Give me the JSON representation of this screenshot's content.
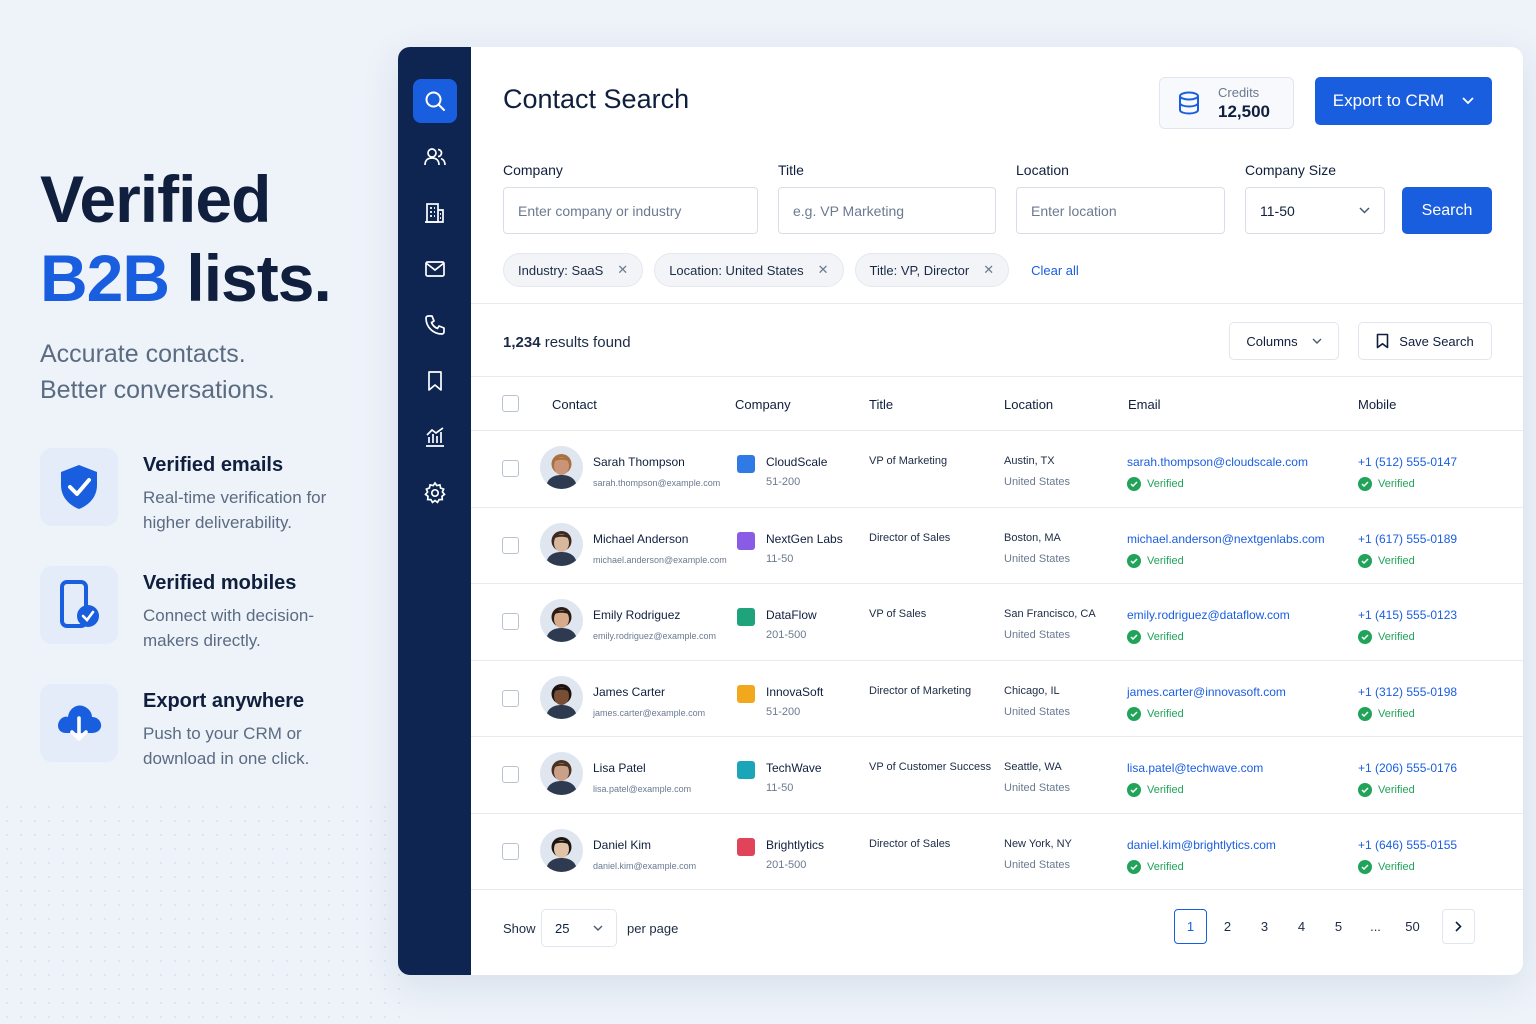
{
  "promo": {
    "headline_line1": "Verified",
    "headline_accent": "B2B",
    "headline_rest": " lists.",
    "subtitle_line1": "Accurate contacts.",
    "subtitle_line2": "Better conversations.",
    "features": [
      {
        "title": "Verified emails",
        "desc": "Real-time verification for higher deliverability.",
        "icon": "shield-check-icon"
      },
      {
        "title": "Verified mobiles",
        "desc": "Connect with decision-makers directly.",
        "icon": "phone-check-icon"
      },
      {
        "title": "Export anywhere",
        "desc": "Push to your CRM or download in one click.",
        "icon": "cloud-download-icon"
      }
    ]
  },
  "sidebar": {
    "items": [
      {
        "icon": "search-icon",
        "active": true
      },
      {
        "icon": "users-icon"
      },
      {
        "icon": "building-icon"
      },
      {
        "icon": "mail-icon"
      },
      {
        "icon": "phone-icon"
      },
      {
        "icon": "bookmark-icon"
      },
      {
        "icon": "analytics-icon"
      },
      {
        "icon": "settings-icon"
      }
    ]
  },
  "header": {
    "title": "Contact Search",
    "credits_label": "Credits",
    "credits_value": "12,500",
    "export_label": "Export to CRM"
  },
  "filters": {
    "company_label": "Company",
    "company_placeholder": "Enter company or industry",
    "title_label": "Title",
    "title_placeholder": "e.g. VP Marketing",
    "location_label": "Location",
    "location_placeholder": "Enter location",
    "size_label": "Company Size",
    "size_value": "11-50",
    "search_label": "Search"
  },
  "chips": [
    {
      "label": "Industry: SaaS"
    },
    {
      "label": "Location: United States"
    },
    {
      "label": "Title: VP, Director"
    }
  ],
  "clear_all": "Clear all",
  "results": {
    "count": "1,234",
    "suffix": " results found",
    "columns_label": "Columns",
    "save_search_label": "Save Search"
  },
  "table": {
    "headers": [
      "Contact",
      "Company",
      "Title",
      "Location",
      "Email",
      "Mobile"
    ],
    "verified_label": "Verified",
    "rows": [
      {
        "name": "Sarah Thompson",
        "personal_email": "sarah.thompson@example.com",
        "company": "CloudScale",
        "size": "51-200",
        "title": "VP of Marketing",
        "city": "Austin, TX",
        "country": "United States",
        "email": "sarah.thompson@cloudscale.com",
        "phone": "+1 (512) 555-0147",
        "logo_color": "#2f7ae5",
        "avatar_bg": "#c99478",
        "hair": "#a8703f"
      },
      {
        "name": "Michael Anderson",
        "personal_email": "michael.anderson@example.com",
        "company": "NextGen Labs",
        "size": "11-50",
        "title": "Director of Sales",
        "city": "Boston, MA",
        "country": "United States",
        "email": "michael.anderson@nextgenlabs.com",
        "phone": "+1 (617) 555-0189",
        "logo_color": "#8a5ce6",
        "avatar_bg": "#d9b79c",
        "hair": "#3b2a1f"
      },
      {
        "name": "Emily Rodriguez",
        "personal_email": "emily.rodriguez@example.com",
        "company": "DataFlow",
        "size": "201-500",
        "title": "VP of Sales",
        "city": "San Francisco, CA",
        "country": "United States",
        "email": "emily.rodriguez@dataflow.com",
        "phone": "+1 (415) 555-0123",
        "logo_color": "#1fa37a",
        "avatar_bg": "#d6ab8c",
        "hair": "#2a1c14"
      },
      {
        "name": "James Carter",
        "personal_email": "james.carter@example.com",
        "company": "InnovaSoft",
        "size": "51-200",
        "title": "Director of Marketing",
        "city": "Chicago, IL",
        "country": "United States",
        "email": "james.carter@innovasoft.com",
        "phone": "+1 (312) 555-0198",
        "logo_color": "#f2a81d",
        "avatar_bg": "#7a4e35",
        "hair": "#1a1410"
      },
      {
        "name": "Lisa Patel",
        "personal_email": "lisa.patel@example.com",
        "company": "TechWave",
        "size": "11-50",
        "title": "VP of Customer Success",
        "city": "Seattle, WA",
        "country": "United States",
        "email": "lisa.patel@techwave.com",
        "phone": "+1 (206) 555-0176",
        "logo_color": "#1aa6b8",
        "avatar_bg": "#c9a088",
        "hair": "#4a3220"
      },
      {
        "name": "Daniel Kim",
        "personal_email": "daniel.kim@example.com",
        "company": "Brightlytics",
        "size": "201-500",
        "title": "Director of Sales",
        "city": "New York, NY",
        "country": "United States",
        "email": "daniel.kim@brightlytics.com",
        "phone": "+1 (646) 555-0155",
        "logo_color": "#e0445a",
        "avatar_bg": "#e2c2a6",
        "hair": "#1c1612"
      }
    ]
  },
  "footer": {
    "show_label": "Show",
    "per_page_value": "25",
    "per_page_label": "per page",
    "pages": [
      "1",
      "2",
      "3",
      "4",
      "5",
      "...",
      "50"
    ],
    "current_page": "1"
  },
  "colors": {
    "accent": "#1a5ee0",
    "sidebar": "#0d2550",
    "verified": "#21a35a"
  }
}
